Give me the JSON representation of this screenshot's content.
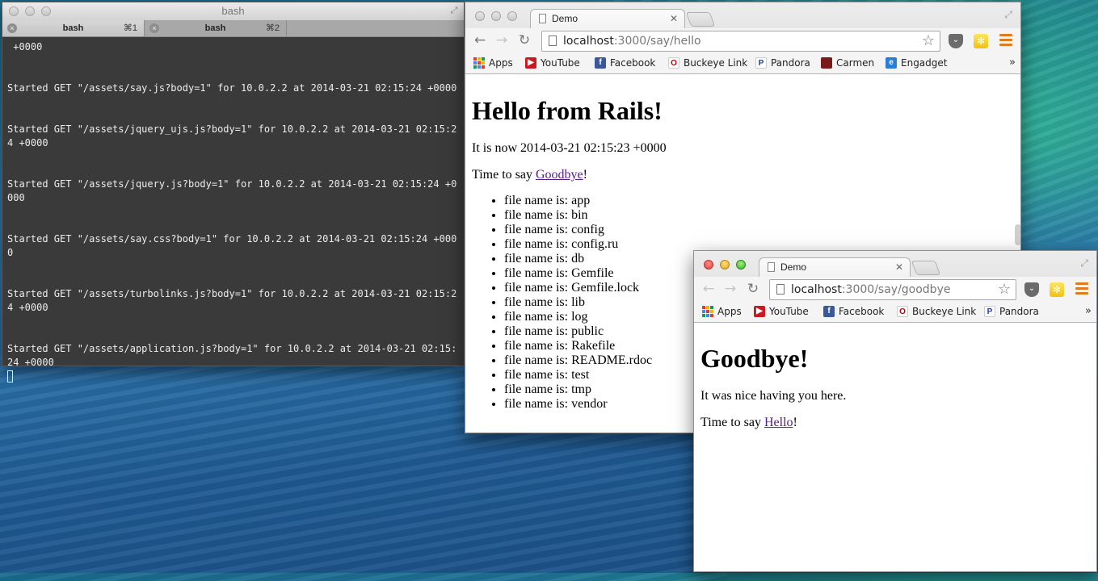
{
  "terminal": {
    "title": "bash",
    "tabs": [
      {
        "label": "bash",
        "shortcut": "⌘1"
      },
      {
        "label": "bash",
        "shortcut": "⌘2"
      }
    ],
    "lines": [
      " +0000",
      "",
      "",
      "Started GET \"/assets/say.js?body=1\" for 10.0.2.2 at 2014-03-21 02:15:24 +0000",
      "",
      "",
      "Started GET \"/assets/jquery_ujs.js?body=1\" for 10.0.2.2 at 2014-03-21 02:15:24 +0000",
      "",
      "",
      "Started GET \"/assets/jquery.js?body=1\" for 10.0.2.2 at 2014-03-21 02:15:24 +0000",
      "",
      "",
      "Started GET \"/assets/say.css?body=1\" for 10.0.2.2 at 2014-03-21 02:15:24 +0000",
      "",
      "",
      "Started GET \"/assets/turbolinks.js?body=1\" for 10.0.2.2 at 2014-03-21 02:15:24 +0000",
      "",
      "",
      "Started GET \"/assets/application.js?body=1\" for 10.0.2.2 at 2014-03-21 02:15:24 +0000"
    ]
  },
  "browser_hello": {
    "tab_title": "Demo",
    "url_host": "localhost",
    "url_path": ":3000/say/hello",
    "bookmarks": [
      "Apps",
      "YouTube",
      "Facebook",
      "Buckeye Link",
      "Pandora",
      "Carmen",
      "Engadget"
    ],
    "overflow": "»",
    "heading": "Hello from Rails!",
    "time_text": "It is now 2014-03-21 02:15:23 +0000",
    "say_prefix": "Time to say ",
    "say_link": "Goodbye",
    "say_suffix": "!",
    "files": [
      "file name is: app",
      "file name is: bin",
      "file name is: config",
      "file name is: config.ru",
      "file name is: db",
      "file name is: Gemfile",
      "file name is: Gemfile.lock",
      "file name is: lib",
      "file name is: log",
      "file name is: public",
      "file name is: Rakefile",
      "file name is: README.rdoc",
      "file name is: test",
      "file name is: tmp",
      "file name is: vendor"
    ]
  },
  "browser_goodbye": {
    "tab_title": "Demo",
    "url_host": "localhost",
    "url_path": ":3000/say/goodbye",
    "bookmarks": [
      "Apps",
      "YouTube",
      "Facebook",
      "Buckeye Link",
      "Pandora"
    ],
    "overflow": "»",
    "heading": "Goodbye!",
    "message": "It was nice having you here.",
    "say_prefix": "Time to say ",
    "say_link": "Hello",
    "say_suffix": "!"
  },
  "colors": {
    "terminal_bg": "#3a3a3a",
    "terminal_text": "#ededed",
    "visited_link": "#551a8b",
    "youtube": "#cc181e",
    "facebook": "#3b5998",
    "buckeye": "#bb0000",
    "pandora": "#224099"
  }
}
